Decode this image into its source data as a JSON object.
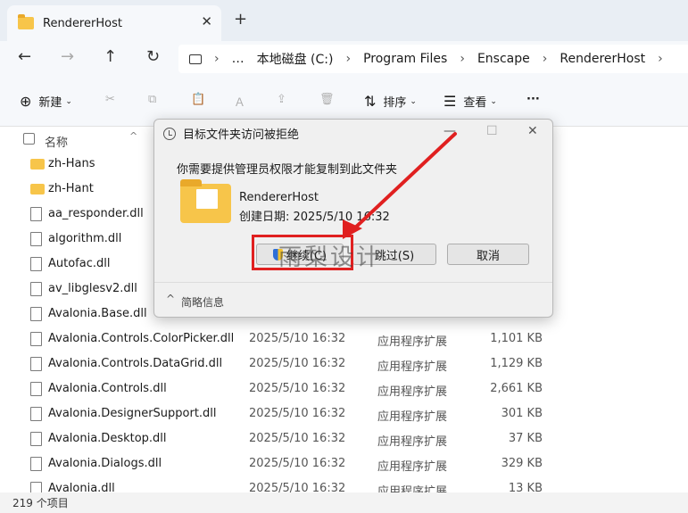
{
  "tab": {
    "title": "RendererHost",
    "close": "✕",
    "new": "+"
  },
  "nav": {
    "back": "←",
    "forward": "→",
    "up": "↑",
    "refresh": "↻"
  },
  "path": {
    "more": "…",
    "crumbs": [
      "本地磁盘 (C:)",
      "Program Files",
      "Enscape",
      "RendererHost"
    ],
    "sep": "›"
  },
  "toolbar": {
    "new": "新建",
    "sort": "排序",
    "view": "查看",
    "more": "···"
  },
  "list": {
    "header_name": "名称",
    "rows": [
      {
        "name": "zh-Hans",
        "date": "",
        "type": "",
        "size": "",
        "folder": true
      },
      {
        "name": "zh-Hant",
        "date": "",
        "type": "",
        "size": "",
        "folder": true
      },
      {
        "name": "aa_responder.dll",
        "date": "",
        "type": "",
        "size": ""
      },
      {
        "name": "algorithm.dll",
        "date": "",
        "type": "",
        "size": ""
      },
      {
        "name": "Autofac.dll",
        "date": "",
        "type": "",
        "size": ""
      },
      {
        "name": "av_libglesv2.dll",
        "date": "",
        "type": "",
        "size": ""
      },
      {
        "name": "Avalonia.Base.dll",
        "date": "",
        "type": "",
        "size": ""
      },
      {
        "name": "Avalonia.Controls.ColorPicker.dll",
        "date": "2025/5/10 16:32",
        "type": "应用程序扩展",
        "size": "1,101 KB"
      },
      {
        "name": "Avalonia.Controls.DataGrid.dll",
        "date": "2025/5/10 16:32",
        "type": "应用程序扩展",
        "size": "1,129 KB"
      },
      {
        "name": "Avalonia.Controls.dll",
        "date": "2025/5/10 16:32",
        "type": "应用程序扩展",
        "size": "2,661 KB"
      },
      {
        "name": "Avalonia.DesignerSupport.dll",
        "date": "2025/5/10 16:32",
        "type": "应用程序扩展",
        "size": "301 KB"
      },
      {
        "name": "Avalonia.Desktop.dll",
        "date": "2025/5/10 16:32",
        "type": "应用程序扩展",
        "size": "37 KB"
      },
      {
        "name": "Avalonia.Dialogs.dll",
        "date": "2025/5/10 16:32",
        "type": "应用程序扩展",
        "size": "329 KB"
      },
      {
        "name": "Avalonia.dll",
        "date": "2025/5/10 16:32",
        "type": "应用程序扩展",
        "size": "13 KB"
      }
    ]
  },
  "status": {
    "count": "219 个项目"
  },
  "dialog": {
    "title": "目标文件夹访问被拒绝",
    "message": "你需要提供管理员权限才能复制到此文件夹",
    "folder_name": "RendererHost",
    "folder_date": "创建日期: 2025/5/10 16:32",
    "continue": "继续(C)",
    "skip": "跳过(S)",
    "cancel": "取消",
    "details": "简略信息",
    "minimize": "—",
    "maximize": "☐",
    "close": "✕"
  },
  "watermark": "雨梨设计",
  "colors": {
    "highlight": "#e02020",
    "folder": "#f7c54a"
  }
}
